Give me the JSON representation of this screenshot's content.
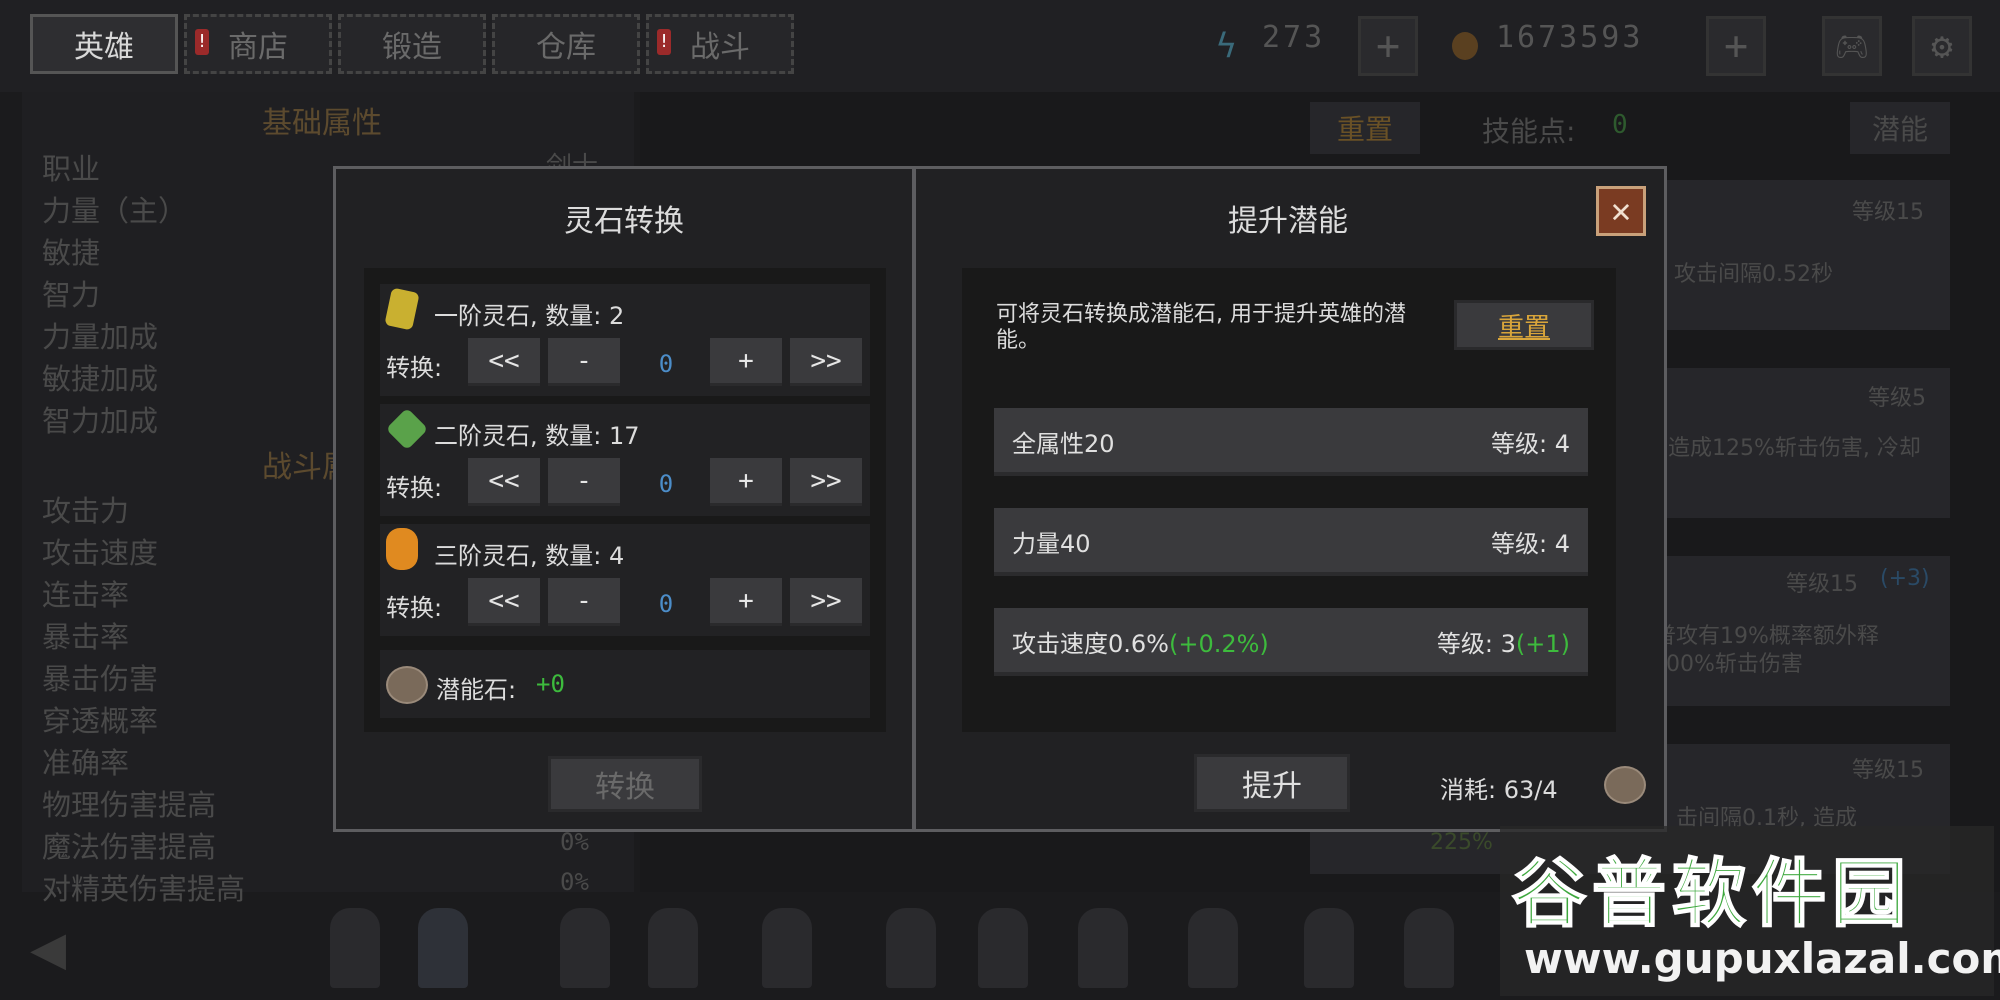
{
  "topbar": {
    "tabs": [
      {
        "label": "英雄",
        "warn": false
      },
      {
        "label": "商店",
        "warn": true
      },
      {
        "label": "锻造",
        "warn": false
      },
      {
        "label": "仓库",
        "warn": false
      },
      {
        "label": "战斗",
        "warn": true
      }
    ],
    "energy": "273",
    "coins": "1673593",
    "plus": "+",
    "warn_mark": "!"
  },
  "background": {
    "basic_title": "基础属性",
    "job_value": "剑士",
    "basic_attrs": [
      "职业",
      "力量（主）",
      "敏捷",
      "智力",
      "力量加成",
      "敏捷加成",
      "智力加成"
    ],
    "battle_title": "战斗属",
    "battle_attrs": [
      "攻击力",
      "攻击速度",
      "连击率",
      "暴击率",
      "暴击伤害",
      "穿透概率",
      "准确率",
      "物理伤害提高",
      "魔法伤害提高",
      "对精英伤害提高"
    ],
    "zero_percent": "0%",
    "reset": "重置",
    "skill_points_label": "技能点:",
    "skill_points": "0",
    "potential_tab": "潜能",
    "skills": [
      {
        "level": "等级15",
        "desc": "攻击间隔0.52秒"
      },
      {
        "level": "等级5",
        "desc": "造成125%斩击伤害, 冷却"
      },
      {
        "level": "等级15",
        "bonus": "(+3)",
        "desc": "普攻有19%概率额外释",
        "desc2": "00%斩击伤害"
      },
      {
        "level": "等级15",
        "desc": "击间隔0.1秒, 造成",
        "desc2": "225%"
      }
    ]
  },
  "dialog": {
    "left_title": "灵石转换",
    "right_title": "提升潜能",
    "stones": [
      {
        "name": "一阶灵石, 数量: 2",
        "color": "#c9b030",
        "value": "0"
      },
      {
        "name": "二阶灵石, 数量: 17",
        "color": "#5aa24a",
        "value": "0"
      },
      {
        "name": "三阶灵石, 数量: 4",
        "color": "#e08a20",
        "value": "0"
      }
    ],
    "convert_label": "转换:",
    "btn_ll": "<<",
    "btn_minus": "-",
    "btn_plus": "+",
    "btn_rr": ">>",
    "potential_stone_label": "潜能石:",
    "potential_stone_value": "+0",
    "convert_button": "转换",
    "description": "可将灵石转换成潜能石, 用于提升英雄的潜能。",
    "reset_button": "重置",
    "potentials": [
      {
        "name": "全属性20",
        "name_bonus": "",
        "level": "等级: 4",
        "level_bonus": ""
      },
      {
        "name": "力量40",
        "name_bonus": "",
        "level": "等级: 4",
        "level_bonus": ""
      },
      {
        "name": "攻击速度0.6%",
        "name_bonus": "(+0.2%)",
        "level": "等级: 3",
        "level_bonus": "(+1)"
      }
    ],
    "upgrade_button": "提升",
    "cost_label": "消耗: 63/4",
    "close": "✕"
  },
  "watermark": {
    "title": "谷普软件园",
    "url": "www.gupuxlazal.com"
  },
  "colors": {
    "accent_gold": "#d9a53a",
    "green": "#3dbb3d",
    "blue_value": "#4c8dc8"
  }
}
